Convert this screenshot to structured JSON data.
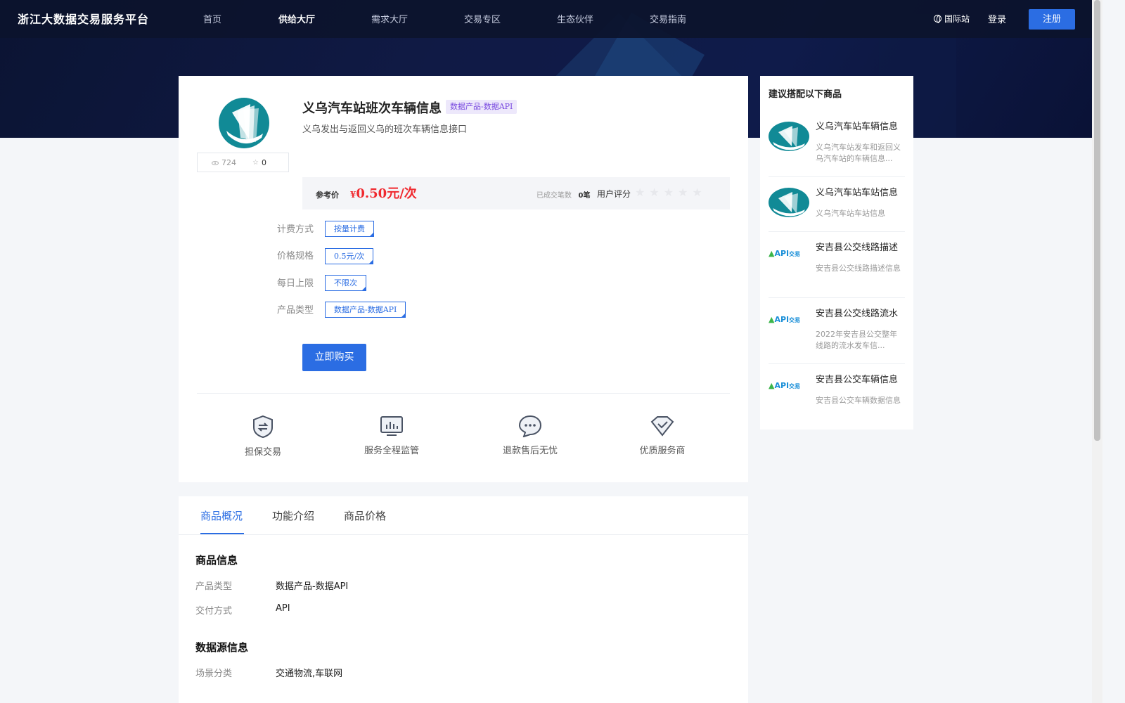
{
  "header": {
    "logo": "浙江大数据交易服务平台",
    "nav": [
      "首页",
      "供给大厅",
      "需求大厅",
      "交易专区",
      "生态伙伴",
      "交易指南"
    ],
    "active_nav": "供给大厅",
    "intl": "国际站",
    "login": "登录",
    "register": "注册"
  },
  "product": {
    "title": "义乌汽车站班次车辆信息",
    "tag": "数据产品-数据API",
    "subtitle": "义乌发出与返回义乌的班次车辆信息接口",
    "views": "724",
    "favorites": "0",
    "price_label": "参考价",
    "price_currency": "¥",
    "price": "0.50元/次",
    "deals_label": "已成交笔数",
    "deals_value": "0笔",
    "rating_label": "用户评分",
    "rating": 0,
    "specs": [
      {
        "key": "计费方式",
        "value": "按量计费"
      },
      {
        "key": "价格规格",
        "value": "0.5元/次"
      },
      {
        "key": "每日上限",
        "value": "不限次"
      },
      {
        "key": "产品类型",
        "value": "数据产品-数据API"
      }
    ],
    "buy": "立即购买",
    "features": [
      "担保交易",
      "服务全程监管",
      "退款售后无忧",
      "优质服务商"
    ]
  },
  "tabs": {
    "items": [
      "商品概况",
      "功能介绍",
      "商品价格"
    ],
    "active": "商品概况"
  },
  "overview": {
    "section1": "商品信息",
    "rows1": [
      {
        "key": "产品类型",
        "value": "数据产品-数据API"
      },
      {
        "key": "交付方式",
        "value": "API"
      }
    ],
    "section2": "数据源信息",
    "rows2": [
      {
        "key": "场景分类",
        "value": "交通物流,车联网"
      }
    ]
  },
  "sidebar": {
    "title": "建议搭配以下商品",
    "items": [
      {
        "name": "义乌汽车站车辆信息",
        "desc": "义乌汽车站发车和返回义乌汽车站的车辆信息...",
        "logo": "yiwu"
      },
      {
        "name": "义乌汽车站车站信息",
        "desc": "义乌汽车站车站信息",
        "logo": "yiwu"
      },
      {
        "name": "安吉县公交线路描述",
        "desc": "安吉县公交线路描述信息",
        "logo": "api"
      },
      {
        "name": "安吉县公交线路流水",
        "desc": "2022年安吉县公交整年线路的流水发车信...",
        "logo": "api"
      },
      {
        "name": "安吉县公交车辆信息",
        "desc": "安吉县公交车辆数据信息",
        "logo": "api"
      }
    ],
    "api_logo_text": "API",
    "api_logo_sub": "交易"
  },
  "colors": {
    "accent": "#2b6de3",
    "price": "#f0292f",
    "header_bg": "#0c132c"
  }
}
